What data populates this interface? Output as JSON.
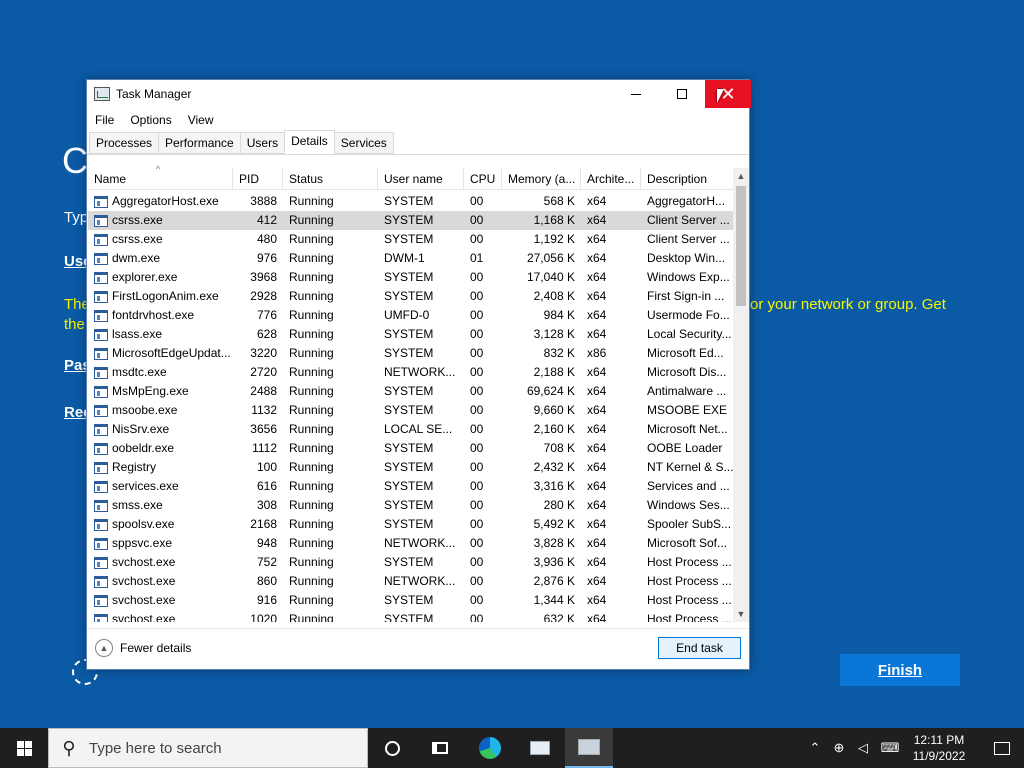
{
  "oobe": {
    "big_letter": "C",
    "typ": "Typ",
    "use": "Use",
    "the1": "The",
    "the2": "the",
    "network_text": "or your network or group. Get",
    "pas": "Pas",
    "ree": "Ree",
    "finish_label": "Finish"
  },
  "window": {
    "title": "Task Manager",
    "close_glyph": "✕"
  },
  "menu": [
    "File",
    "Options",
    "View"
  ],
  "tabs": [
    "Processes",
    "Performance",
    "Users",
    "Details",
    "Services"
  ],
  "active_tab": "Details",
  "columns": [
    "Name",
    "PID",
    "Status",
    "User name",
    "CPU",
    "Memory (a...",
    "Archite...",
    "Description"
  ],
  "rows": [
    [
      "AggregatorHost.exe",
      "3888",
      "Running",
      "SYSTEM",
      "00",
      "568 K",
      "x64",
      "AggregatorH..."
    ],
    [
      "csrss.exe",
      "412",
      "Running",
      "SYSTEM",
      "00",
      "1,168 K",
      "x64",
      "Client Server ..."
    ],
    [
      "csrss.exe",
      "480",
      "Running",
      "SYSTEM",
      "00",
      "1,192 K",
      "x64",
      "Client Server ..."
    ],
    [
      "dwm.exe",
      "976",
      "Running",
      "DWM-1",
      "01",
      "27,056 K",
      "x64",
      "Desktop Win..."
    ],
    [
      "explorer.exe",
      "3968",
      "Running",
      "SYSTEM",
      "00",
      "17,040 K",
      "x64",
      "Windows Exp..."
    ],
    [
      "FirstLogonAnim.exe",
      "2928",
      "Running",
      "SYSTEM",
      "00",
      "2,408 K",
      "x64",
      "First Sign-in ..."
    ],
    [
      "fontdrvhost.exe",
      "776",
      "Running",
      "UMFD-0",
      "00",
      "984 K",
      "x64",
      "Usermode Fo..."
    ],
    [
      "lsass.exe",
      "628",
      "Running",
      "SYSTEM",
      "00",
      "3,128 K",
      "x64",
      "Local Security..."
    ],
    [
      "MicrosoftEdgeUpdat...",
      "3220",
      "Running",
      "SYSTEM",
      "00",
      "832 K",
      "x86",
      "Microsoft Ed..."
    ],
    [
      "msdtc.exe",
      "2720",
      "Running",
      "NETWORK...",
      "00",
      "2,188 K",
      "x64",
      "Microsoft Dis..."
    ],
    [
      "MsMpEng.exe",
      "2488",
      "Running",
      "SYSTEM",
      "00",
      "69,624 K",
      "x64",
      "Antimalware ..."
    ],
    [
      "msoobe.exe",
      "1132",
      "Running",
      "SYSTEM",
      "00",
      "9,660 K",
      "x64",
      "MSOOBE EXE"
    ],
    [
      "NisSrv.exe",
      "3656",
      "Running",
      "LOCAL SE...",
      "00",
      "2,160 K",
      "x64",
      "Microsoft Net..."
    ],
    [
      "oobeldr.exe",
      "1112",
      "Running",
      "SYSTEM",
      "00",
      "708 K",
      "x64",
      "OOBE Loader"
    ],
    [
      "Registry",
      "100",
      "Running",
      "SYSTEM",
      "00",
      "2,432 K",
      "x64",
      "NT Kernel & S..."
    ],
    [
      "services.exe",
      "616",
      "Running",
      "SYSTEM",
      "00",
      "3,316 K",
      "x64",
      "Services and ..."
    ],
    [
      "smss.exe",
      "308",
      "Running",
      "SYSTEM",
      "00",
      "280 K",
      "x64",
      "Windows Ses..."
    ],
    [
      "spoolsv.exe",
      "2168",
      "Running",
      "SYSTEM",
      "00",
      "5,492 K",
      "x64",
      "Spooler SubS..."
    ],
    [
      "sppsvc.exe",
      "948",
      "Running",
      "NETWORK...",
      "00",
      "3,828 K",
      "x64",
      "Microsoft Sof..."
    ],
    [
      "svchost.exe",
      "752",
      "Running",
      "SYSTEM",
      "00",
      "3,936 K",
      "x64",
      "Host Process ..."
    ],
    [
      "svchost.exe",
      "860",
      "Running",
      "NETWORK...",
      "00",
      "2,876 K",
      "x64",
      "Host Process ..."
    ],
    [
      "svchost.exe",
      "916",
      "Running",
      "SYSTEM",
      "00",
      "1,344 K",
      "x64",
      "Host Process ..."
    ],
    [
      "svchost.exe",
      "1020",
      "Running",
      "SYSTEM",
      "00",
      "632 K",
      "x64",
      "Host Process ..."
    ]
  ],
  "selected_row": 1,
  "footer": {
    "fewer_details": "Fewer details",
    "end_task": "End task"
  },
  "taskbar": {
    "search_placeholder": "Type here to search",
    "time": "12:11 PM",
    "date": "11/9/2022"
  },
  "colors": {
    "desktop_bg": "#0b5aa6",
    "accent": "#0078d7",
    "close_red": "#e81123",
    "oobe_yellow": "#f5f500"
  }
}
